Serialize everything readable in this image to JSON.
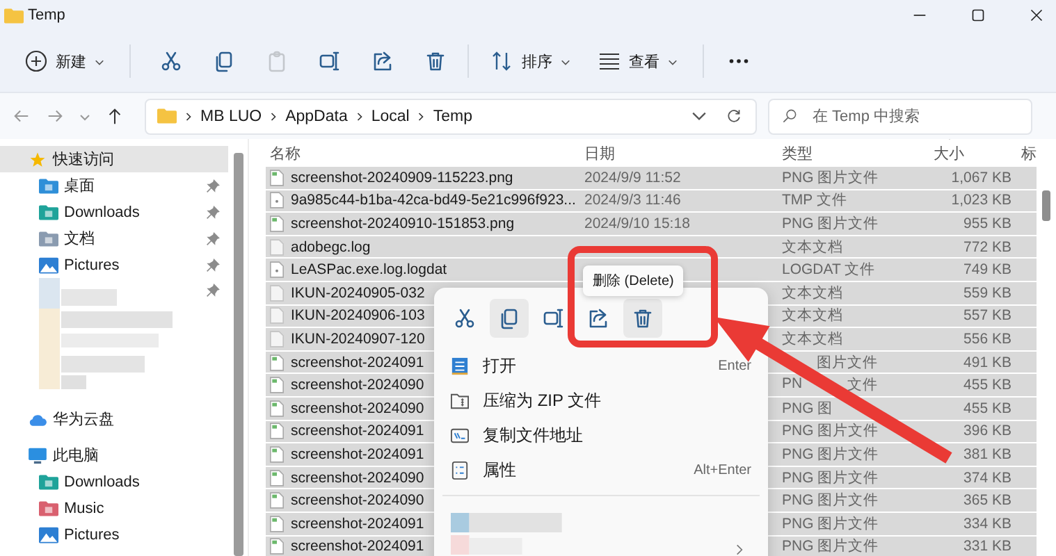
{
  "window": {
    "title": "Temp"
  },
  "toolbar": {
    "new_label": "新建",
    "tools": [
      {
        "kind": "cut",
        "disabled": false
      },
      {
        "kind": "copy",
        "disabled": false
      },
      {
        "kind": "paste",
        "disabled": true
      },
      {
        "kind": "rename",
        "disabled": false
      },
      {
        "kind": "share",
        "disabled": false
      },
      {
        "kind": "delete",
        "disabled": false
      }
    ],
    "sort_label": "排序",
    "view_label": "查看"
  },
  "address": {
    "path": [
      "MB LUO",
      "AppData",
      "Local",
      "Temp"
    ]
  },
  "search": {
    "placeholder": "在 Temp 中搜索"
  },
  "sidebar": {
    "items": [
      {
        "kind": "star",
        "label": "快速访问",
        "selected": true,
        "children": [
          {
            "kind": "desktop",
            "label": "桌面",
            "pinned": true
          },
          {
            "kind": "downloads",
            "label": "Downloads",
            "pinned": true
          },
          {
            "kind": "documents",
            "label": "文档",
            "pinned": true
          },
          {
            "kind": "pictures",
            "label": "Pictures",
            "pinned": true
          },
          {
            "kind": "redacted",
            "pinned": true
          }
        ]
      },
      {
        "kind": "cloud",
        "label": "华为云盘",
        "selected": false
      },
      {
        "kind": "computer",
        "label": "此电脑",
        "selected": false,
        "children": [
          {
            "kind": "downloads",
            "label": "Downloads",
            "pinned": false
          },
          {
            "kind": "music",
            "label": "Music",
            "pinned": false
          },
          {
            "kind": "pictures",
            "label": "Pictures",
            "pinned": false
          }
        ]
      }
    ]
  },
  "table": {
    "columns": [
      {
        "label": "名称",
        "sorted": false
      },
      {
        "label": "日期",
        "sorted": false
      },
      {
        "label": "类型",
        "sorted": false
      },
      {
        "label": "大小",
        "sorted": true
      },
      {
        "label": "标",
        "sorted": false
      }
    ],
    "rows": [
      {
        "kind": "image",
        "name": "screenshot-20240909-115223.png",
        "date": "2024/9/9 11:52",
        "type": "PNG 图片文件",
        "size": "1,067 KB",
        "selected": true
      },
      {
        "kind": "file",
        "name": "9a985c44-b1ba-42ca-bd49-5e21c996f923...",
        "date": "2024/9/3 11:46",
        "type": "TMP 文件",
        "size": "1,023 KB",
        "selected": true
      },
      {
        "kind": "image",
        "name": "screenshot-20240910-151853.png",
        "date": "2024/9/10 15:18",
        "type": "PNG 图片文件",
        "size": "955 KB",
        "selected": true
      },
      {
        "kind": "text",
        "name": "adobegc.log",
        "type": "文本文档",
        "size": "772 KB",
        "selected": true
      },
      {
        "kind": "file",
        "name": "LeASPac.exe.log.logdat",
        "type": "LOGDAT 文件",
        "size": "749 KB",
        "selected": true
      },
      {
        "kind": "text",
        "name": "IKUN-20240905-032",
        "type": "文本文档",
        "size": "559 KB",
        "selected": true
      },
      {
        "kind": "text",
        "name": "IKUN-20240906-103",
        "type": "文本文档",
        "size": "557 KB",
        "selected": true
      },
      {
        "kind": "text",
        "name": "IKUN-20240907-120",
        "type": "文本文档",
        "size": "556 KB",
        "selected": true
      },
      {
        "kind": "image",
        "name": "screenshot-2024091",
        "type_tail": "图片文件",
        "size": "491 KB",
        "selected": true
      },
      {
        "kind": "image",
        "name": "screenshot-2024090",
        "type": "PN",
        "type_tail": "文件",
        "size": "455 KB",
        "selected": true
      },
      {
        "kind": "image",
        "name": "screenshot-2024090",
        "type": "PNG 图",
        "size": "455 KB",
        "selected": true
      },
      {
        "kind": "image",
        "name": "screenshot-2024091",
        "type": "PNG 图片文件",
        "size": "396 KB",
        "selected": true
      },
      {
        "kind": "image",
        "name": "screenshot-2024091",
        "type": "PNG 图片文件",
        "size": "381 KB",
        "selected": true
      },
      {
        "kind": "image",
        "name": "screenshot-2024090",
        "type": "PNG 图片文件",
        "size": "374 KB",
        "selected": true
      },
      {
        "kind": "image",
        "name": "screenshot-2024090",
        "type": "PNG 图片文件",
        "size": "365 KB",
        "selected": true
      },
      {
        "kind": "image",
        "name": "screenshot-2024091",
        "type": "PNG 图片文件",
        "size": "334 KB",
        "selected": true
      },
      {
        "kind": "image",
        "name": "screenshot-2024091",
        "type": "PNG 图片文件",
        "size": "331 KB",
        "selected": true
      }
    ]
  },
  "context_menu": {
    "actions": [
      {
        "kind": "cut",
        "highlighted": false
      },
      {
        "kind": "copy",
        "highlighted": true
      },
      {
        "kind": "rename",
        "highlighted": false
      },
      {
        "kind": "share",
        "highlighted": false
      },
      {
        "kind": "delete",
        "highlighted": true
      }
    ],
    "tooltip": "删除 (Delete)",
    "items": [
      {
        "kind": "open",
        "label": "打开",
        "shortcut": "Enter"
      },
      {
        "kind": "zip",
        "label": "压缩为 ZIP 文件"
      },
      {
        "kind": "copy-path",
        "label": "复制文件地址"
      },
      {
        "kind": "properties",
        "label": "属性",
        "shortcut": "Alt+Enter"
      },
      {
        "kind": "redacted",
        "submenu": true
      }
    ]
  }
}
